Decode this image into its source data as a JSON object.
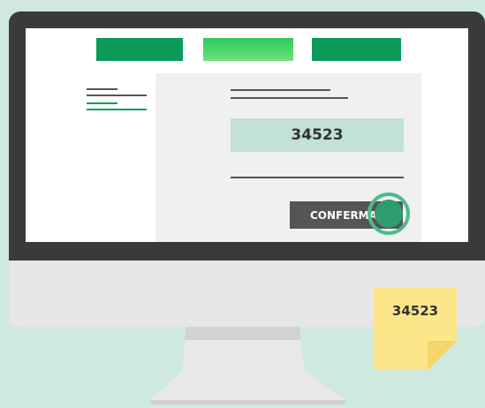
{
  "nav": {
    "tabs": [
      {
        "label": "",
        "color": "#0b9a5a"
      },
      {
        "label": "",
        "color": "#3ed46b"
      },
      {
        "label": "",
        "color": "#0b9a5a"
      }
    ]
  },
  "form": {
    "code_value": "34523",
    "confirm_label": "CONFERMA"
  },
  "sticky_note": {
    "text": "34523",
    "color": "#fde68a"
  },
  "colors": {
    "background": "#cfe9df",
    "accent": "#0b9a5a",
    "highlight": "#4dbb8c"
  }
}
